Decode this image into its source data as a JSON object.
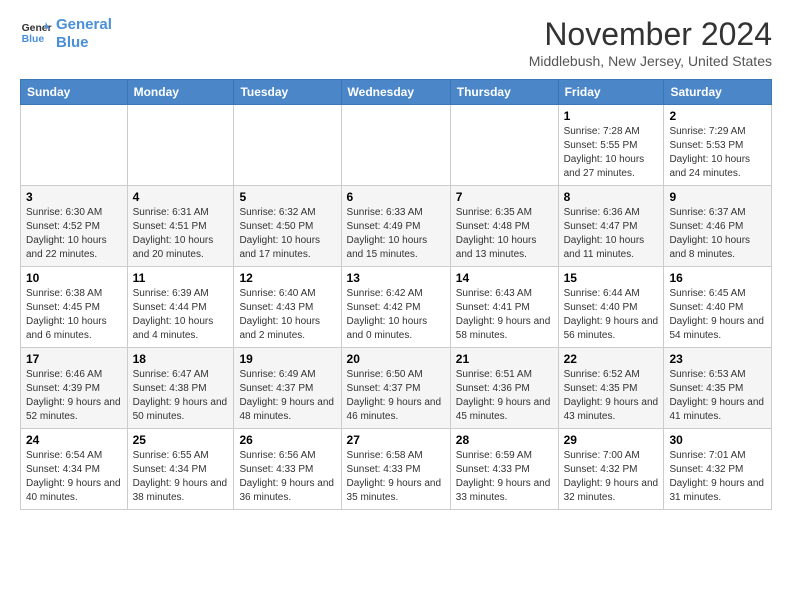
{
  "logo": {
    "line1": "General",
    "line2": "Blue"
  },
  "title": "November 2024",
  "subtitle": "Middlebush, New Jersey, United States",
  "days_of_week": [
    "Sunday",
    "Monday",
    "Tuesday",
    "Wednesday",
    "Thursday",
    "Friday",
    "Saturday"
  ],
  "weeks": [
    [
      {
        "day": "",
        "info": ""
      },
      {
        "day": "",
        "info": ""
      },
      {
        "day": "",
        "info": ""
      },
      {
        "day": "",
        "info": ""
      },
      {
        "day": "",
        "info": ""
      },
      {
        "day": "1",
        "info": "Sunrise: 7:28 AM\nSunset: 5:55 PM\nDaylight: 10 hours and 27 minutes."
      },
      {
        "day": "2",
        "info": "Sunrise: 7:29 AM\nSunset: 5:53 PM\nDaylight: 10 hours and 24 minutes."
      }
    ],
    [
      {
        "day": "3",
        "info": "Sunrise: 6:30 AM\nSunset: 4:52 PM\nDaylight: 10 hours and 22 minutes."
      },
      {
        "day": "4",
        "info": "Sunrise: 6:31 AM\nSunset: 4:51 PM\nDaylight: 10 hours and 20 minutes."
      },
      {
        "day": "5",
        "info": "Sunrise: 6:32 AM\nSunset: 4:50 PM\nDaylight: 10 hours and 17 minutes."
      },
      {
        "day": "6",
        "info": "Sunrise: 6:33 AM\nSunset: 4:49 PM\nDaylight: 10 hours and 15 minutes."
      },
      {
        "day": "7",
        "info": "Sunrise: 6:35 AM\nSunset: 4:48 PM\nDaylight: 10 hours and 13 minutes."
      },
      {
        "day": "8",
        "info": "Sunrise: 6:36 AM\nSunset: 4:47 PM\nDaylight: 10 hours and 11 minutes."
      },
      {
        "day": "9",
        "info": "Sunrise: 6:37 AM\nSunset: 4:46 PM\nDaylight: 10 hours and 8 minutes."
      }
    ],
    [
      {
        "day": "10",
        "info": "Sunrise: 6:38 AM\nSunset: 4:45 PM\nDaylight: 10 hours and 6 minutes."
      },
      {
        "day": "11",
        "info": "Sunrise: 6:39 AM\nSunset: 4:44 PM\nDaylight: 10 hours and 4 minutes."
      },
      {
        "day": "12",
        "info": "Sunrise: 6:40 AM\nSunset: 4:43 PM\nDaylight: 10 hours and 2 minutes."
      },
      {
        "day": "13",
        "info": "Sunrise: 6:42 AM\nSunset: 4:42 PM\nDaylight: 10 hours and 0 minutes."
      },
      {
        "day": "14",
        "info": "Sunrise: 6:43 AM\nSunset: 4:41 PM\nDaylight: 9 hours and 58 minutes."
      },
      {
        "day": "15",
        "info": "Sunrise: 6:44 AM\nSunset: 4:40 PM\nDaylight: 9 hours and 56 minutes."
      },
      {
        "day": "16",
        "info": "Sunrise: 6:45 AM\nSunset: 4:40 PM\nDaylight: 9 hours and 54 minutes."
      }
    ],
    [
      {
        "day": "17",
        "info": "Sunrise: 6:46 AM\nSunset: 4:39 PM\nDaylight: 9 hours and 52 minutes."
      },
      {
        "day": "18",
        "info": "Sunrise: 6:47 AM\nSunset: 4:38 PM\nDaylight: 9 hours and 50 minutes."
      },
      {
        "day": "19",
        "info": "Sunrise: 6:49 AM\nSunset: 4:37 PM\nDaylight: 9 hours and 48 minutes."
      },
      {
        "day": "20",
        "info": "Sunrise: 6:50 AM\nSunset: 4:37 PM\nDaylight: 9 hours and 46 minutes."
      },
      {
        "day": "21",
        "info": "Sunrise: 6:51 AM\nSunset: 4:36 PM\nDaylight: 9 hours and 45 minutes."
      },
      {
        "day": "22",
        "info": "Sunrise: 6:52 AM\nSunset: 4:35 PM\nDaylight: 9 hours and 43 minutes."
      },
      {
        "day": "23",
        "info": "Sunrise: 6:53 AM\nSunset: 4:35 PM\nDaylight: 9 hours and 41 minutes."
      }
    ],
    [
      {
        "day": "24",
        "info": "Sunrise: 6:54 AM\nSunset: 4:34 PM\nDaylight: 9 hours and 40 minutes."
      },
      {
        "day": "25",
        "info": "Sunrise: 6:55 AM\nSunset: 4:34 PM\nDaylight: 9 hours and 38 minutes."
      },
      {
        "day": "26",
        "info": "Sunrise: 6:56 AM\nSunset: 4:33 PM\nDaylight: 9 hours and 36 minutes."
      },
      {
        "day": "27",
        "info": "Sunrise: 6:58 AM\nSunset: 4:33 PM\nDaylight: 9 hours and 35 minutes."
      },
      {
        "day": "28",
        "info": "Sunrise: 6:59 AM\nSunset: 4:33 PM\nDaylight: 9 hours and 33 minutes."
      },
      {
        "day": "29",
        "info": "Sunrise: 7:00 AM\nSunset: 4:32 PM\nDaylight: 9 hours and 32 minutes."
      },
      {
        "day": "30",
        "info": "Sunrise: 7:01 AM\nSunset: 4:32 PM\nDaylight: 9 hours and 31 minutes."
      }
    ]
  ]
}
